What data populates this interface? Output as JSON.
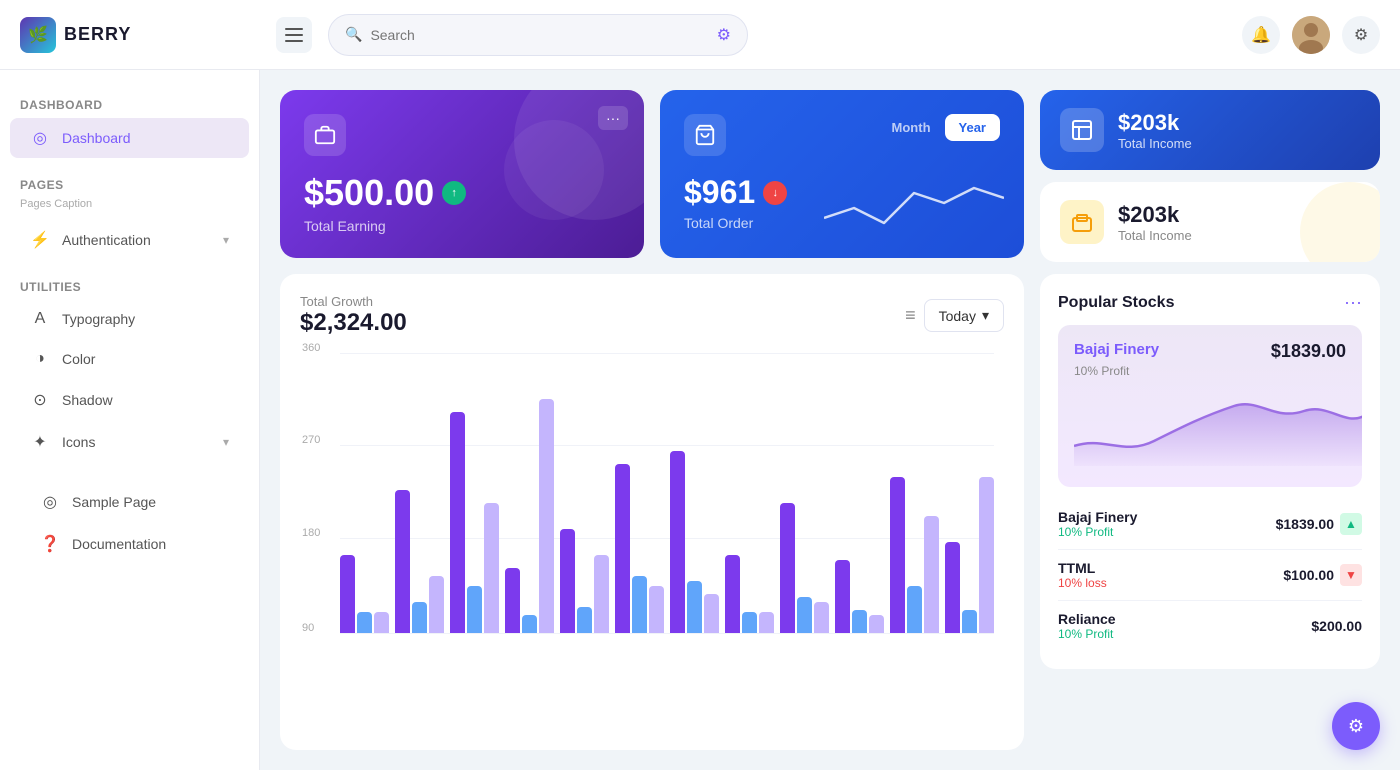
{
  "app": {
    "logo_text": "BERRY",
    "search_placeholder": "Search"
  },
  "sidebar": {
    "section_dashboard": "Dashboard",
    "nav_dashboard": "Dashboard",
    "section_pages": "Pages",
    "pages_caption": "Pages Caption",
    "nav_authentication": "Authentication",
    "section_utilities": "Utilities",
    "nav_typography": "Typography",
    "nav_color": "Color",
    "nav_shadow": "Shadow",
    "nav_icons": "Icons",
    "nav_sample_page": "Sample Page",
    "nav_documentation": "Documentation"
  },
  "cards": {
    "earning_amount": "$500.00",
    "earning_label": "Total Earning",
    "order_amount": "$961",
    "order_label": "Total Order",
    "toggle_month": "Month",
    "toggle_year": "Year",
    "income_blue_amount": "$203k",
    "income_blue_label": "Total Income",
    "income_yellow_amount": "$203k",
    "income_yellow_label": "Total Income"
  },
  "chart": {
    "title": "Total Growth",
    "amount": "$2,324.00",
    "period_btn": "Today",
    "y_labels": [
      "360",
      "270",
      "180",
      "90"
    ],
    "bars": [
      {
        "purple": 30,
        "blue": 8,
        "light": 8
      },
      {
        "purple": 55,
        "blue": 12,
        "light": 22
      },
      {
        "purple": 85,
        "blue": 18,
        "light": 50
      },
      {
        "purple": 25,
        "blue": 7,
        "light": 90
      },
      {
        "purple": 40,
        "blue": 10,
        "light": 30
      },
      {
        "purple": 65,
        "blue": 22,
        "light": 18
      },
      {
        "purple": 70,
        "blue": 20,
        "light": 15
      },
      {
        "purple": 30,
        "blue": 8,
        "light": 8
      },
      {
        "purple": 50,
        "blue": 14,
        "light": 12
      },
      {
        "purple": 28,
        "blue": 9,
        "light": 7
      },
      {
        "purple": 60,
        "blue": 18,
        "light": 45
      },
      {
        "purple": 35,
        "blue": 9,
        "light": 60
      }
    ]
  },
  "stocks": {
    "title": "Popular Stocks",
    "featured_name": "Bajaj Finery",
    "featured_price": "$1839.00",
    "featured_profit": "10% Profit",
    "items": [
      {
        "name": "Bajaj Finery",
        "sub": "10% Profit",
        "price": "$1839.00",
        "trend": "up"
      },
      {
        "name": "TTML",
        "sub": "10% loss",
        "price": "$100.00",
        "trend": "down"
      },
      {
        "name": "Reliance",
        "sub": "10% Profit",
        "price": "$200.00",
        "trend": "up"
      }
    ]
  }
}
